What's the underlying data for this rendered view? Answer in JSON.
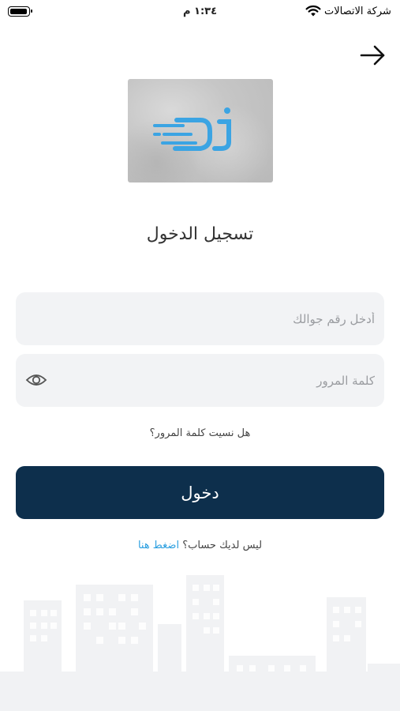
{
  "status_bar": {
    "carrier": "شركة الاتصالات",
    "time": "١:٣٤ م"
  },
  "title": "تسجيل الدخول",
  "phone_field": {
    "placeholder": "أدخل رقم جوالك"
  },
  "password_field": {
    "placeholder": "كلمة المرور"
  },
  "forgot_password": "هل نسيت كلمة المرور؟",
  "login_button": "دخول",
  "signup": {
    "prompt": "ليس لديك حساب؟",
    "link": "اضغط هنا"
  },
  "icons": [
    "battery-icon",
    "wifi-icon",
    "back-arrow-icon",
    "eye-icon",
    "app-logo"
  ],
  "colors": {
    "primary": "#0d2f4c",
    "link": "#2b9fe0",
    "field_bg": "#f2f3f5",
    "logo_blue": "#3ba4e3"
  }
}
